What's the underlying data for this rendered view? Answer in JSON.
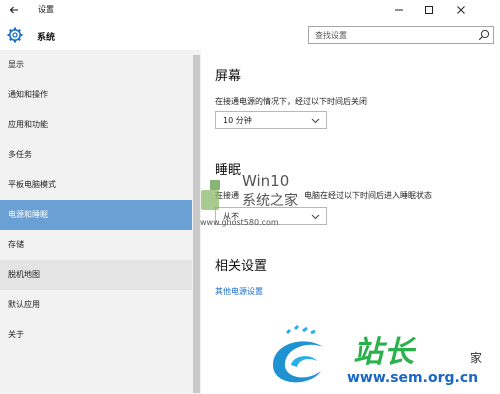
{
  "window": {
    "title": "设置",
    "back_icon": "arrow-left-icon",
    "min_icon": "minimize-icon",
    "max_icon": "maximize-icon",
    "close_icon": "close-icon"
  },
  "header": {
    "title": "系统",
    "icon": "gear-icon",
    "search": {
      "placeholder": "查找设置",
      "value": "",
      "icon": "search-icon"
    }
  },
  "sidebar": {
    "items": [
      {
        "label": "显示",
        "state": "normal"
      },
      {
        "label": "通知和操作",
        "state": "normal"
      },
      {
        "label": "应用和功能",
        "state": "normal"
      },
      {
        "label": "多任务",
        "state": "normal"
      },
      {
        "label": "平板电脑模式",
        "state": "normal"
      },
      {
        "label": "电源和睡眠",
        "state": "selected"
      },
      {
        "label": "存储",
        "state": "normal"
      },
      {
        "label": "脱机地图",
        "state": "hover"
      },
      {
        "label": "默认应用",
        "state": "normal"
      },
      {
        "label": "关于",
        "state": "normal"
      }
    ],
    "selected_color": "#6aa0d4"
  },
  "main": {
    "screen": {
      "heading": "屏幕",
      "description": "在接通电源的情况下，经过以下时间后关闭",
      "dropdown_value": "10 分钟"
    },
    "sleep": {
      "heading": "睡眠",
      "description_left": "在接通",
      "description_right": "电脑在经过以下时间后进入睡眠状态",
      "dropdown_value": "从不"
    },
    "related": {
      "heading": "相关设置",
      "link": "其他电源设置"
    }
  },
  "watermarks": {
    "win10_line1": "Win10",
    "win10_line2": "系统之家",
    "win10_url": "www.ghost580.com",
    "site_name": "站长",
    "site_sub": "家",
    "site_url": "www.sem.org.cn"
  },
  "colors": {
    "accent": "#6aa0d4",
    "link": "#1a6fc7",
    "sidebar_bg": "#f2f2f2"
  }
}
